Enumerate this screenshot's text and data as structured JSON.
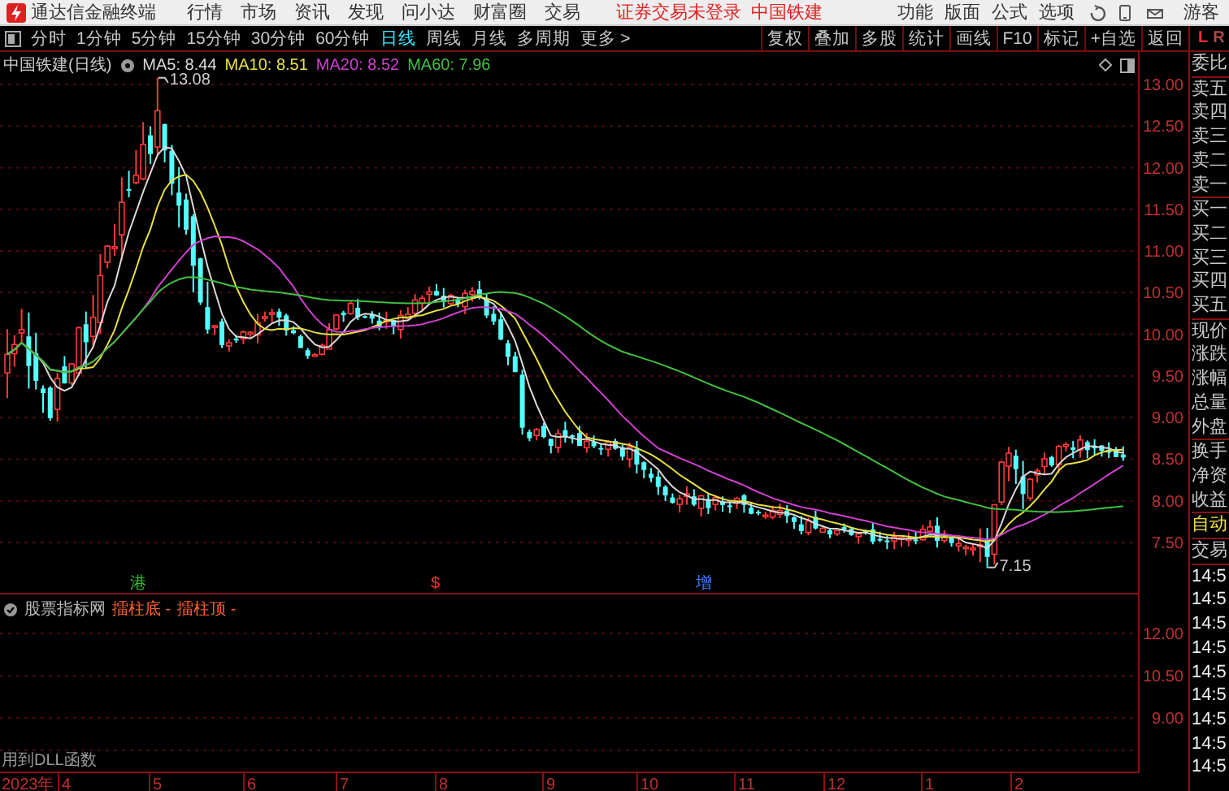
{
  "app_bar": {
    "title": "通达信金融终端",
    "menus": [
      "行情",
      "市场",
      "资讯",
      "发现",
      "问小达",
      "财富圈",
      "交易"
    ],
    "notice": "证券交易未登录",
    "stock": "中国铁建",
    "tools": [
      "功能",
      "版面",
      "公式",
      "选项"
    ],
    "user": "游客"
  },
  "toolbar": {
    "periods": [
      {
        "label": "分时",
        "selected": false
      },
      {
        "label": "1分钟",
        "selected": false
      },
      {
        "label": "5分钟",
        "selected": false
      },
      {
        "label": "15分钟",
        "selected": false
      },
      {
        "label": "30分钟",
        "selected": false
      },
      {
        "label": "60分钟",
        "selected": false
      },
      {
        "label": "日线",
        "selected": true
      },
      {
        "label": "周线",
        "selected": false
      },
      {
        "label": "月线",
        "selected": false
      },
      {
        "label": "多周期",
        "selected": false
      },
      {
        "label": "更多 >",
        "selected": false
      }
    ],
    "actions": [
      "复权",
      "叠加",
      "多股",
      "统计",
      "画线",
      "F10",
      "标记",
      "+自选",
      "返回"
    ],
    "side_switch": [
      {
        "label": "L",
        "selected": true
      },
      {
        "label": "R",
        "selected": false
      }
    ]
  },
  "chart": {
    "title": "中国铁建(日线)",
    "averages": [
      {
        "label": "MA5: 8.44",
        "color": "#d8d8d8"
      },
      {
        "label": "MA10: 8.51",
        "color": "#e8e040"
      },
      {
        "label": "MA20: 8.52",
        "color": "#d040d0"
      },
      {
        "label": "MA60: 7.96",
        "color": "#40c040"
      }
    ],
    "high_label": "13.08",
    "low_label": "7.15",
    "markers": [
      {
        "text": "港",
        "color": "#30c030"
      },
      {
        "text": "$",
        "color": "#ff3030"
      },
      {
        "text": "增",
        "color": "#4080ff"
      }
    ],
    "y_labels": [
      "13.00",
      "12.50",
      "12.00",
      "11.50",
      "11.00",
      "10.50",
      "10.00",
      "9.50",
      "9.00",
      "8.50",
      "8.00",
      "7.50"
    ]
  },
  "indicator": {
    "source": "股票指标网",
    "series": [
      "擂柱底 -",
      "擂柱顶 -"
    ],
    "y_labels": [
      "12.00",
      "10.50",
      "9.00"
    ],
    "note": "用到DLL函数"
  },
  "date_axis": {
    "year": "2023年",
    "months": [
      "4",
      "5",
      "6",
      "7",
      "8",
      "9",
      "10",
      "11",
      "12",
      "1",
      "2"
    ]
  },
  "quote_panel": {
    "groups": [
      [
        {
          "text": "委比",
          "kind": "label"
        }
      ],
      [
        {
          "text": "卖五",
          "kind": "label"
        },
        {
          "text": "卖四",
          "kind": "label"
        },
        {
          "text": "卖三",
          "kind": "label"
        },
        {
          "text": "卖二",
          "kind": "label"
        },
        {
          "text": "卖一",
          "kind": "label"
        }
      ],
      [
        {
          "text": "买一",
          "kind": "label"
        },
        {
          "text": "买二",
          "kind": "label"
        },
        {
          "text": "买三",
          "kind": "label"
        },
        {
          "text": "买四",
          "kind": "label"
        },
        {
          "text": "买五",
          "kind": "label"
        }
      ],
      [
        {
          "text": "现价",
          "kind": "label"
        },
        {
          "text": "涨跌",
          "kind": "label"
        },
        {
          "text": "涨幅",
          "kind": "label"
        },
        {
          "text": "总量",
          "kind": "label"
        },
        {
          "text": "外盘",
          "kind": "label"
        }
      ],
      [
        {
          "text": "换手",
          "kind": "label"
        },
        {
          "text": "净资",
          "kind": "label"
        },
        {
          "text": "收益",
          "kind": "label"
        }
      ],
      [
        {
          "text": "自动",
          "kind": "mode"
        }
      ],
      [
        {
          "text": "交易",
          "kind": "label"
        }
      ]
    ],
    "times": [
      "14:5",
      "14:5",
      "14:5",
      "14:5",
      "14:5",
      "14:5",
      "14:5",
      "14:5",
      "14:5"
    ]
  }
}
